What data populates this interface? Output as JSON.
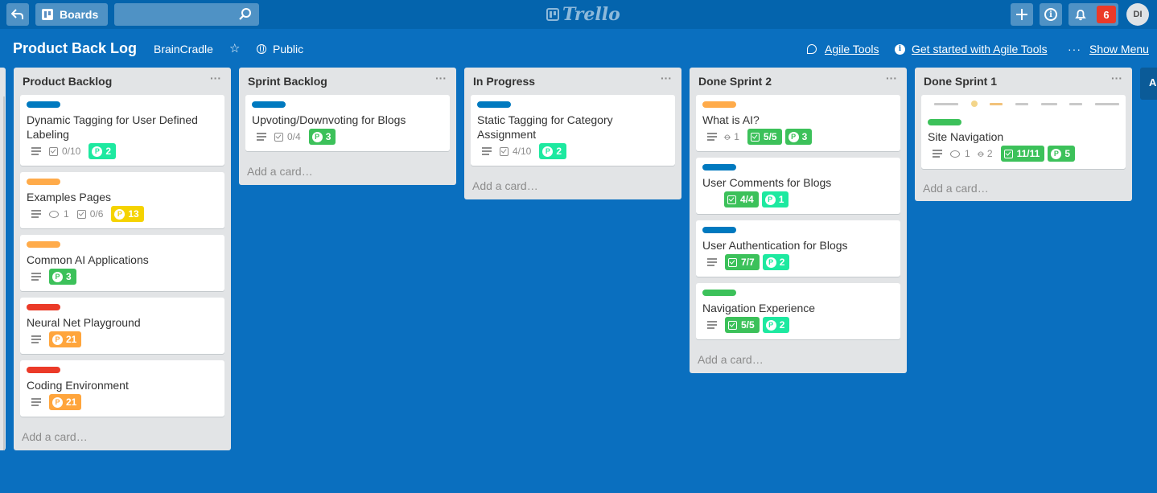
{
  "topbar": {
    "boards_label": "Boards",
    "search_value": "",
    "logo_text": "Trello",
    "notification_count": "6",
    "avatar_initials": "DI"
  },
  "board": {
    "title": "Product Back Log",
    "team": "BrainCradle",
    "visibility": "Public",
    "agile_tools": "Agile Tools",
    "get_started": "Get started with Agile Tools",
    "show_menu": "Show Menu",
    "next_list_stub": "A"
  },
  "colors": {
    "board_bg": "#0a6fbf",
    "label_blue": "#0079bf",
    "label_orange": "#ffab4a",
    "label_red": "#eb5a46",
    "label_green": "#61bd4f",
    "points_mint": "#1de9a0",
    "points_green": "#3cc15a",
    "points_yellow": "#f5d300",
    "points_orange": "#ffa53c",
    "checklist_done": "#3cc15a"
  },
  "add_card_label": "Add a card…",
  "lists": [
    {
      "title": "Product Backlog",
      "cards": [
        {
          "label": "blue",
          "title": "Dynamic Tagging for User Defined Labeling",
          "checklist": "0/10",
          "points": "2",
          "points_color": "mint"
        },
        {
          "label": "orange",
          "title": "Examples Pages",
          "comments": "1",
          "checklist": "0/6",
          "points": "13",
          "points_color": "yellow"
        },
        {
          "label": "orange",
          "title": "Common AI Applications",
          "points": "3",
          "points_color": "green"
        },
        {
          "label": "red",
          "title": "Neural Net Playground",
          "points": "21",
          "points_color": "orange"
        },
        {
          "label": "red",
          "title": "Coding Environment",
          "points": "21",
          "points_color": "orange"
        }
      ]
    },
    {
      "title": "Sprint Backlog",
      "cards": [
        {
          "label": "blue",
          "title": "Upvoting/Downvoting for Blogs",
          "checklist": "0/4",
          "points": "3",
          "points_color": "green"
        }
      ]
    },
    {
      "title": "In Progress",
      "cards": [
        {
          "label": "blue",
          "title": "Static Tagging for Category Assignment",
          "checklist": "4/10",
          "points": "2",
          "points_color": "mint"
        }
      ]
    },
    {
      "title": "Done Sprint 2",
      "cards": [
        {
          "label": "orange",
          "title": "What is AI?",
          "attachments": "1",
          "checklist": "5/5",
          "points": "3",
          "points_color": "green"
        },
        {
          "label": "blue",
          "title": "User Comments for Blogs",
          "checklist": "4/4",
          "points": "1",
          "points_color": "mint"
        },
        {
          "label": "blue",
          "title": "User Authentication for Blogs",
          "checklist": "7/7",
          "points": "2",
          "points_color": "mint"
        },
        {
          "label": "green",
          "title": "Navigation Experience",
          "checklist": "5/5",
          "points": "2",
          "points_color": "mint"
        }
      ]
    },
    {
      "title": "Done Sprint 1",
      "cards": [
        {
          "label": "green",
          "title": "Site Navigation",
          "comments": "1",
          "attachments": "2",
          "checklist": "11/11",
          "points": "5",
          "points_color": "green"
        }
      ]
    }
  ]
}
